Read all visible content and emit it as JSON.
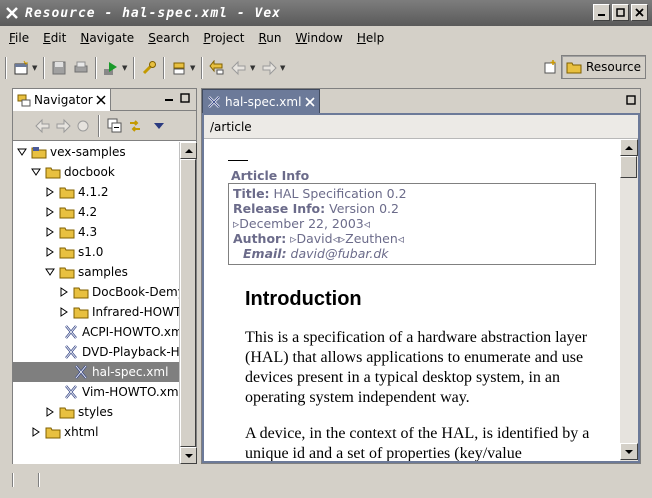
{
  "window": {
    "title": "Resource - hal-spec.xml - Vex"
  },
  "menu": [
    {
      "label": "File"
    },
    {
      "label": "Edit"
    },
    {
      "label": "Navigate"
    },
    {
      "label": "Search"
    },
    {
      "label": "Project"
    },
    {
      "label": "Run"
    },
    {
      "label": "Window"
    },
    {
      "label": "Help"
    }
  ],
  "perspective": {
    "label": "Resource"
  },
  "navigator": {
    "tab_label": "Navigator",
    "tree": [
      {
        "label": "vex-samples",
        "depth": 0,
        "state": "expanded",
        "kind": "project"
      },
      {
        "label": "docbook",
        "depth": 1,
        "state": "expanded",
        "kind": "folder"
      },
      {
        "label": "4.1.2",
        "depth": 2,
        "state": "collapsed",
        "kind": "folder"
      },
      {
        "label": "4.2",
        "depth": 2,
        "state": "collapsed",
        "kind": "folder"
      },
      {
        "label": "4.3",
        "depth": 2,
        "state": "collapsed",
        "kind": "folder"
      },
      {
        "label": "s1.0",
        "depth": 2,
        "state": "collapsed",
        "kind": "folder"
      },
      {
        "label": "samples",
        "depth": 2,
        "state": "expanded",
        "kind": "folder"
      },
      {
        "label": "DocBook-Demy",
        "depth": 3,
        "state": "collapsed",
        "kind": "folder"
      },
      {
        "label": "Infrared-HOWTO",
        "depth": 3,
        "state": "collapsed",
        "kind": "folder"
      },
      {
        "label": "ACPI-HOWTO.xml",
        "depth": 3,
        "state": "leaf",
        "kind": "file"
      },
      {
        "label": "DVD-Playback-HOWTO.xml",
        "depth": 3,
        "state": "leaf",
        "kind": "file"
      },
      {
        "label": "hal-spec.xml",
        "depth": 3,
        "state": "leaf",
        "kind": "file",
        "selected": true
      },
      {
        "label": "Vim-HOWTO.xml",
        "depth": 3,
        "state": "leaf",
        "kind": "file"
      },
      {
        "label": "styles",
        "depth": 2,
        "state": "collapsed",
        "kind": "folder"
      },
      {
        "label": "xhtml",
        "depth": 1,
        "state": "collapsed",
        "kind": "folder"
      }
    ]
  },
  "editor": {
    "tab_label": "hal-spec.xml",
    "breadcrumb": "/article",
    "article_info": {
      "heading": "Article Info",
      "title_label": "Title:",
      "title_value": " HAL Specification 0.2",
      "release_label": "Release Info:",
      "release_value": " Version 0.2",
      "date": "December 22, 2003",
      "author_label": "Author:",
      "author_first": "David",
      "author_last": "Zeuthen",
      "email_label": "Email:",
      "email_value": " david@fubar.dk"
    },
    "section_title": "Introduction",
    "paragraphs": [
      "This is a specification of a hardware abstraction layer (HAL) that allows applications to enumerate and use devices present in a typical desktop system, in an operating system independent way.",
      "A device, in the context of the HAL, is identified by a unique id and a set of properties (key/value"
    ]
  },
  "colors": {
    "active_tab": "#6c7a99",
    "info_text": "#6b6b8a",
    "selection": "#7f7f7f"
  }
}
